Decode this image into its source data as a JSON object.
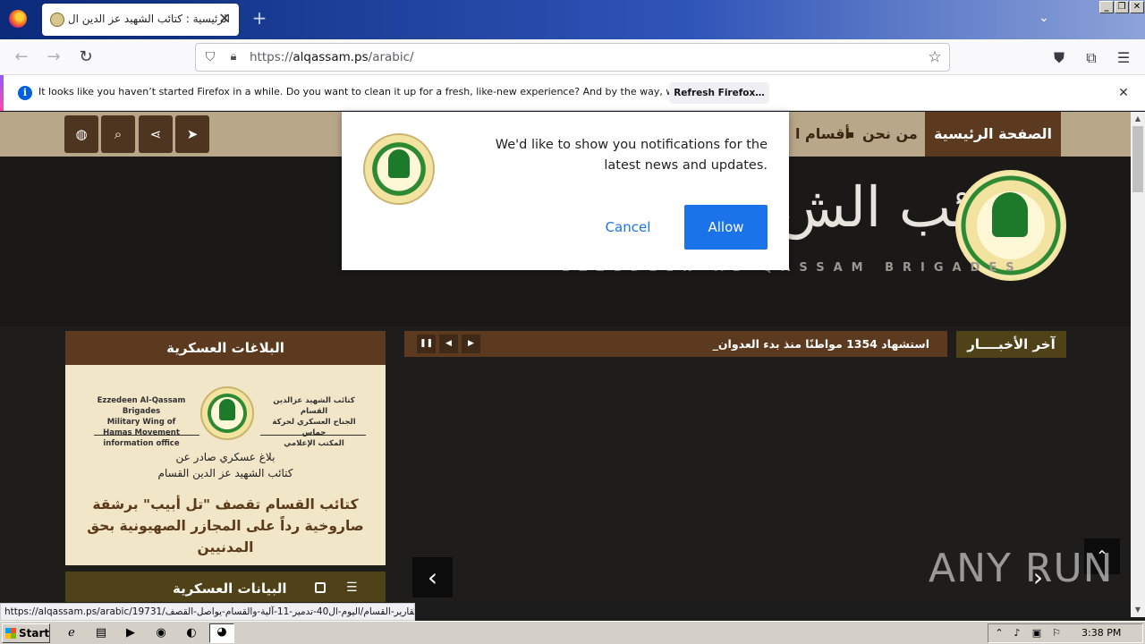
{
  "browser": {
    "tab_title": "الرئيسية : كتائب الشهيد عز الدين ال",
    "tab_close": "✕",
    "new_tab": "+",
    "url_prefix": "https://",
    "url_host": "alqassam.ps",
    "url_path": "/arabic/",
    "infobar_text": "It looks like you haven’t started Firefox in a while. Do you want to clean it up for a fresh, like-new experience? And by the way, welcome back!",
    "infobar_button": "Refresh Firefox…",
    "status_url": "https://alqassam.ps/arabic/19731/تقارير-القسام/اليوم-ال40-تدمير-11-آلية-والقسام-يواصل-القصف"
  },
  "site": {
    "nav": {
      "home": "الصفحة الرئيسية",
      "about": "من نحن",
      "sections": "أقسام ا",
      "dot": "▪"
    },
    "header": {
      "brigades_en": "EZZEDEEN AL-QASSAM BRIGADES",
      "calligraphy": "كتائب الش"
    },
    "ticker": {
      "label": "آخر الأخبــــار",
      "text": "استشهاد 1354 مواطنًا منذ بدء العدوان_"
    },
    "military": {
      "heading": "البلاغات العسكرية",
      "card_en": "Ezzedeen Al-Qassam Brigades\nMilitary Wing of Hamas Movement\ninformation office",
      "card_ar": "كتائب الشهيد عزالدين القسام\nالجناح العسكري لحركة حماس\nالمكتب الإعلامي",
      "line1": "بلاغ عسكري صادر عن",
      "line2": "كتائب الشهيد عز الدين القسام",
      "headline": "كتائب القسام تقصف \"تل أبيب\" برشقة صاروخية رداً على المجازر الصهيونية بحق المدنيين"
    },
    "statements_bar": "البيانات العسكرية"
  },
  "notification": {
    "message": "We'd like to show you notifications for the latest news and updates.",
    "cancel": "Cancel",
    "allow": "Allow"
  },
  "taskbar": {
    "start": "Start",
    "clock": "3:38 PM"
  },
  "watermark": "ANY RUN",
  "colors": {
    "nav_bg": "#b9a78a",
    "brown": "#5b3a1f",
    "olive": "#4f4219",
    "allow_blue": "#1a73e8"
  }
}
